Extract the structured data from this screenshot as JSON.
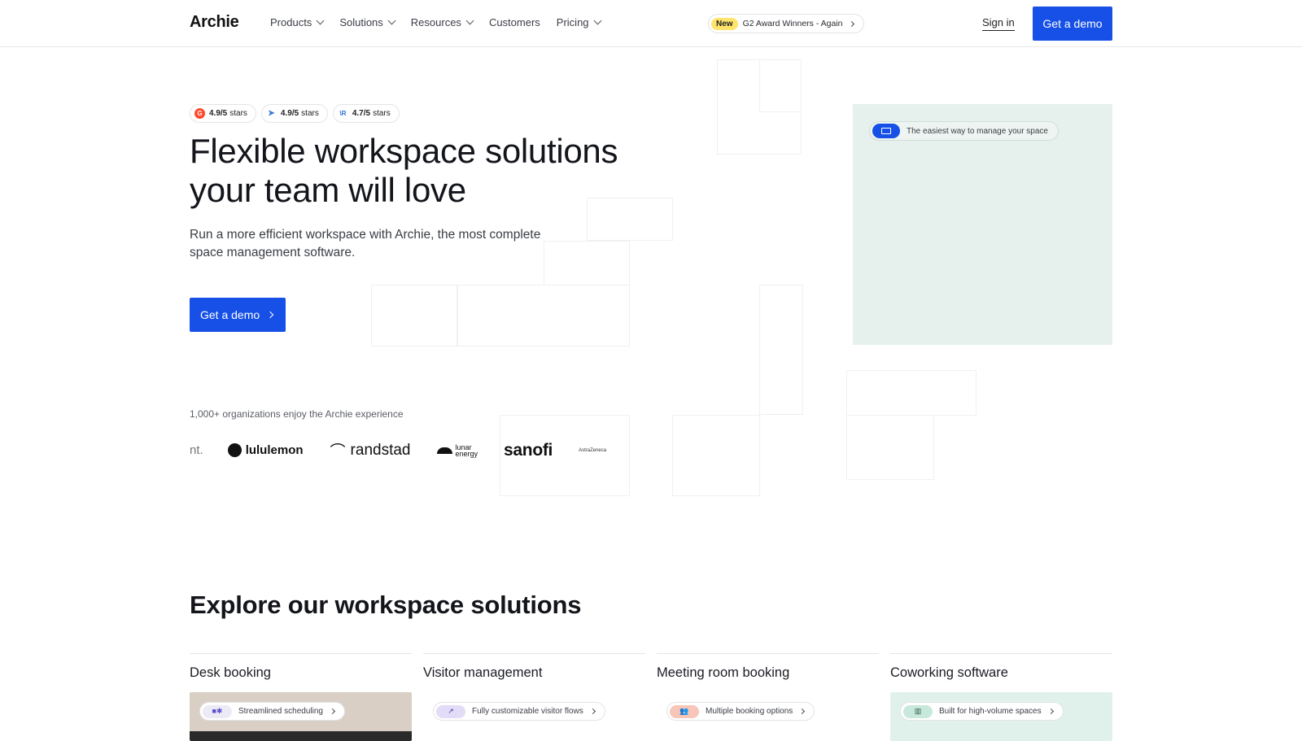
{
  "header": {
    "logo": "Archie",
    "nav": [
      "Products",
      "Solutions",
      "Resources",
      "Customers",
      "Pricing"
    ],
    "nav_has_chevron": [
      true,
      true,
      true,
      false,
      true
    ],
    "award_badge": "New",
    "award_text": "G2 Award Winners - Again",
    "signin": "Sign in",
    "demo": "Get a demo"
  },
  "hero": {
    "ratings": [
      {
        "score": "4.9/5",
        "label": "stars",
        "icon_color": "#ff492c",
        "icon_glyph": "G"
      },
      {
        "score": "4.9/5",
        "label": "stars",
        "icon_color": "#3a7bd5",
        "icon_glyph": "➤"
      },
      {
        "score": "4.7/5",
        "label": "stars",
        "icon_color": "#2a9d8f",
        "icon_glyph": "\\R"
      }
    ],
    "title": "Flexible workspace solutions your team will love",
    "subtitle": "Run a more efficient workspace with Archie, the most complete space management software.",
    "cta": "Get a demo",
    "panel_pill": "The easiest way to manage your space"
  },
  "orgs": {
    "text": "1,000+ organizations enjoy the Archie experience",
    "logos": {
      "partial": "nt.",
      "lululemon": "lululemon",
      "randstad": "randstad",
      "lunar_1": "lunar",
      "lunar_2": "energy",
      "sanofi": "sanofi",
      "astra": "AstraZeneca"
    }
  },
  "explore": {
    "title": "Explore our workspace solutions",
    "cards": [
      {
        "title": "Desk booking",
        "pill": "Streamlined scheduling",
        "bg": "#d8cfc6",
        "pill_bg": "#eceaf5",
        "icon": "teams-slack-icon"
      },
      {
        "title": "Visitor management",
        "pill": "Fully customizable visitor flows",
        "bg": "#ffffff",
        "pill_bg": "#e2dcf7",
        "icon": "flow-icon"
      },
      {
        "title": "Meeting room booking",
        "pill": "Multiple booking options",
        "bg": "#ffffff",
        "pill_bg": "#f7c6b8",
        "icon": "people-icon"
      },
      {
        "title": "Coworking software",
        "pill": "Built for high-volume spaces",
        "bg": "#e0f1ec",
        "pill_bg": "#c9e8dc",
        "icon": "building-icon"
      }
    ]
  },
  "colors": {
    "accent": "#1650e6",
    "panel": "#e6f0ed",
    "award": "#ffe46b"
  }
}
